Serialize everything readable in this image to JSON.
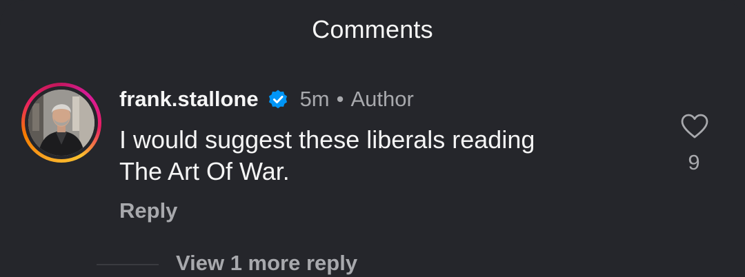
{
  "header": {
    "title": "Comments"
  },
  "comment": {
    "username": "frank.stallone",
    "verified_icon": "verified-badge-icon",
    "time": "5m",
    "separator": "•",
    "role": "Author",
    "text_line1": "I would suggest these liberals reading",
    "text_line2": "The Art Of War.",
    "reply_label": "Reply",
    "like_icon": "heart-icon",
    "like_count": "9",
    "view_more_label": "View 1 more reply"
  },
  "colors": {
    "background": "#25262b",
    "primary_text": "#f5f5f5",
    "secondary_text": "#a8a9ad",
    "verified_blue": "#0095f6"
  }
}
